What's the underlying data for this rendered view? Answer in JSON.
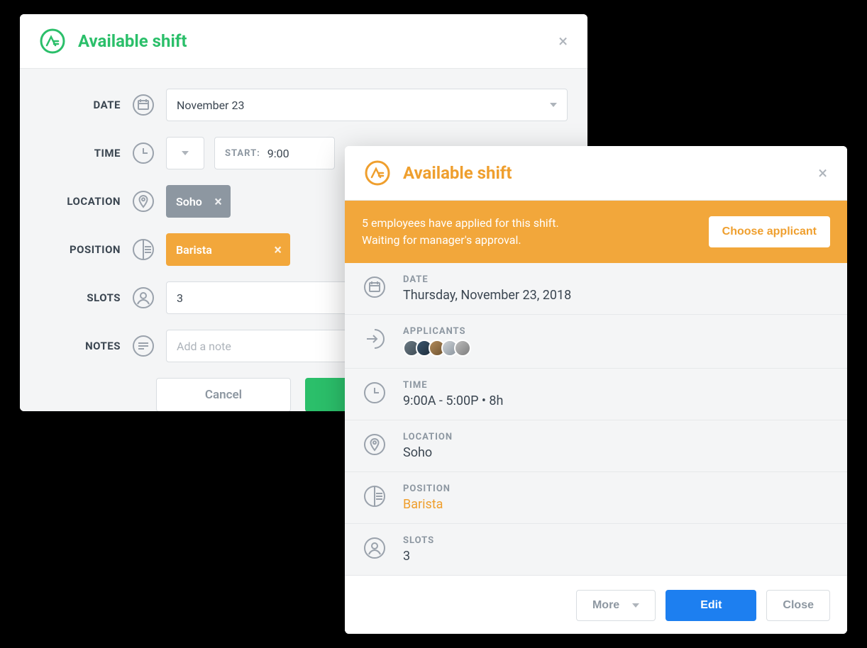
{
  "edit": {
    "title": "Available shift",
    "labels": {
      "date": "DATE",
      "time": "TIME",
      "location": "LOCATION",
      "position": "POSITION",
      "slots": "SLOTS",
      "notes": "NOTES"
    },
    "date_value": "November 23",
    "time_start_label": "START:",
    "time_start_value": "9:00",
    "location_chip": "Soho",
    "position_chip": "Barista",
    "slots_value": "3",
    "notes_placeholder": "Add a note",
    "cancel": "Cancel",
    "save": ""
  },
  "detail": {
    "title": "Available shift",
    "banner_line1": "5 employees have applied for this shift.",
    "banner_line2": "Waiting for manager's approval.",
    "choose_btn": "Choose applicant",
    "rows": {
      "date": {
        "label": "DATE",
        "value": "Thursday, November 23, 2018"
      },
      "applicants": {
        "label": "APPLICANTS"
      },
      "time": {
        "label": "TIME",
        "value": "9:00A - 5:00P • 8h"
      },
      "location": {
        "label": "LOCATION",
        "value": "Soho"
      },
      "position": {
        "label": "POSITION",
        "value": "Barista"
      },
      "slots": {
        "label": "SLOTS",
        "value": "3"
      }
    },
    "footer": {
      "more": "More",
      "edit": "Edit",
      "close": "Close"
    }
  }
}
